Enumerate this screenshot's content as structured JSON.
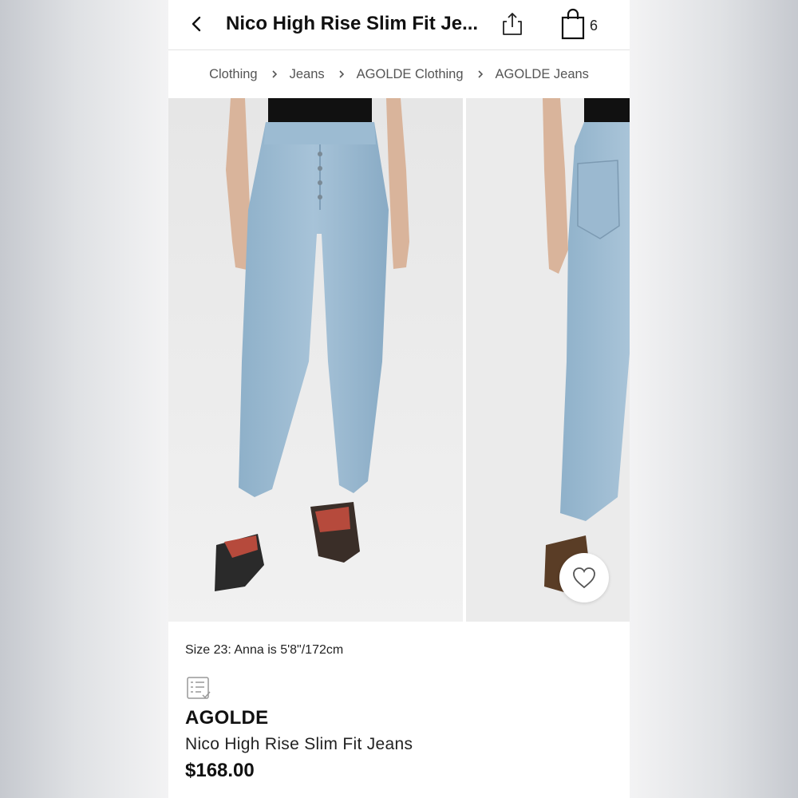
{
  "header": {
    "title": "Nico High Rise Slim Fit Je...",
    "bag_count": "6"
  },
  "breadcrumb": [
    {
      "label": "Clothing"
    },
    {
      "label": "Jeans"
    },
    {
      "label": "AGOLDE Clothing"
    },
    {
      "label": "AGOLDE Jeans"
    }
  ],
  "icons": {
    "back": "chevron-left-icon",
    "share": "share-icon",
    "bag": "shopping-bag-icon",
    "heart": "heart-icon",
    "size_guide": "size-guide-icon"
  },
  "product": {
    "size_note": "Size 23: Anna is 5'8\"/172cm",
    "brand": "AGOLDE",
    "name": "Nico High Rise Slim Fit Jeans",
    "price": "$168.00"
  },
  "colors": {
    "denim": "#9ab8cf",
    "accent_text": "#111111"
  }
}
